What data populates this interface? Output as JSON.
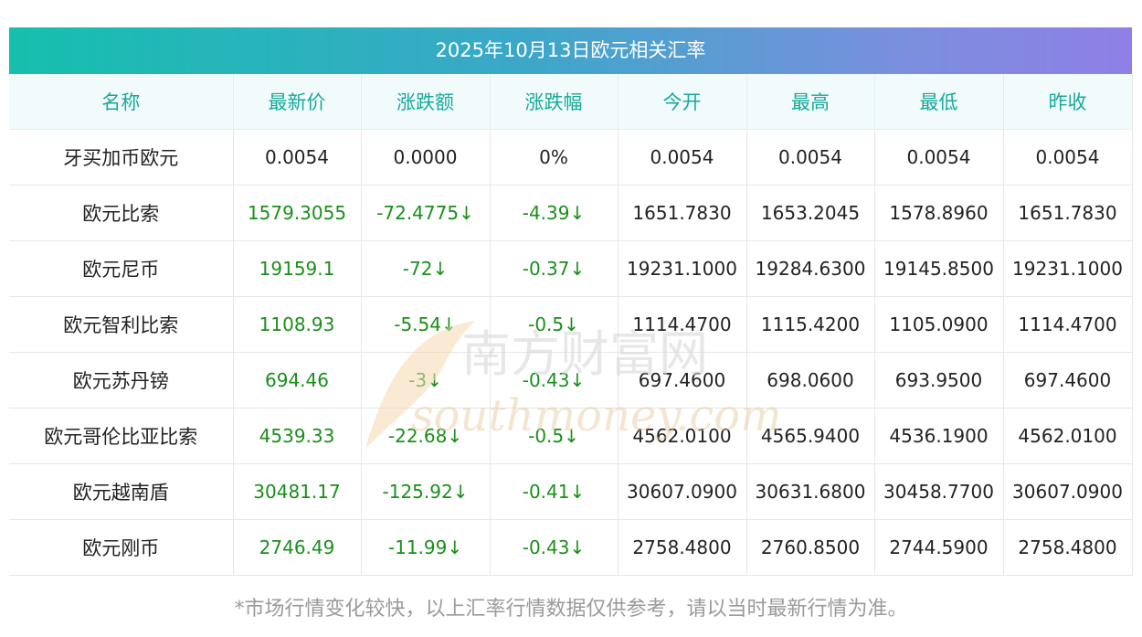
{
  "title": "2025年10月13日欧元相关汇率",
  "headers": [
    "名称",
    "最新价",
    "涨跌额",
    "涨跌幅",
    "今开",
    "最高",
    "最低",
    "昨收"
  ],
  "rows": [
    {
      "name": "牙买加币欧元",
      "latest": "0.0054",
      "change": "0.0000",
      "pct": "0%",
      "open": "0.0054",
      "high": "0.0054",
      "low": "0.0054",
      "prev": "0.0054",
      "down": false
    },
    {
      "name": "欧元比索",
      "latest": "1579.3055",
      "change": "-72.4775↓",
      "pct": "-4.39↓",
      "open": "1651.7830",
      "high": "1653.2045",
      "low": "1578.8960",
      "prev": "1651.7830",
      "down": true
    },
    {
      "name": "欧元尼币",
      "latest": "19159.1",
      "change": "-72↓",
      "pct": "-0.37↓",
      "open": "19231.1000",
      "high": "19284.6300",
      "low": "19145.8500",
      "prev": "19231.1000",
      "down": true
    },
    {
      "name": "欧元智利比索",
      "latest": "1108.93",
      "change": "-5.54↓",
      "pct": "-0.5↓",
      "open": "1114.4700",
      "high": "1115.4200",
      "low": "1105.0900",
      "prev": "1114.4700",
      "down": true
    },
    {
      "name": "欧元苏丹镑",
      "latest": "694.46",
      "change": "-3↓",
      "pct": "-0.43↓",
      "open": "697.4600",
      "high": "698.0600",
      "low": "693.9500",
      "prev": "697.4600",
      "down": true
    },
    {
      "name": "欧元哥伦比亚比索",
      "latest": "4539.33",
      "change": "-22.68↓",
      "pct": "-0.5↓",
      "open": "4562.0100",
      "high": "4565.9400",
      "low": "4536.1900",
      "prev": "4562.0100",
      "down": true
    },
    {
      "name": "欧元越南盾",
      "latest": "30481.17",
      "change": "-125.92↓",
      "pct": "-0.41↓",
      "open": "30607.0900",
      "high": "30631.6800",
      "low": "30458.7700",
      "prev": "30607.0900",
      "down": true
    },
    {
      "name": "欧元刚币",
      "latest": "2746.49",
      "change": "-11.99↓",
      "pct": "-0.43↓",
      "open": "2758.4800",
      "high": "2760.8500",
      "low": "2744.5900",
      "prev": "2758.4800",
      "down": true
    }
  ],
  "watermark": {
    "cn": "南方财富网",
    "en": "southmoney.com"
  },
  "footnote": "*市场行情变化较快，以上汇率行情数据仅供参考，请以当时最新行情为准。",
  "colors": {
    "header_text": "#16a99c",
    "down": "#1a8f1a",
    "gradient_start": "#16bfae",
    "gradient_end": "#8f7fe6"
  }
}
